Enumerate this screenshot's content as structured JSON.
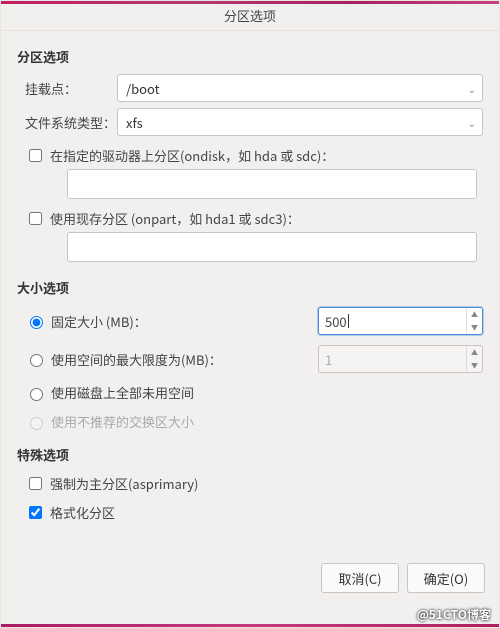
{
  "window": {
    "title": "分区选项"
  },
  "sections": {
    "partition": "分区选项",
    "size": "大小选项",
    "special": "特殊选项"
  },
  "mount": {
    "label": "挂载点：",
    "value": "/boot"
  },
  "fstype": {
    "label": "文件系统类型：",
    "value": "xfs"
  },
  "ondisk": {
    "label": "在指定的驱动器上分区(ondisk，如 hda 或 sdc)：",
    "value": ""
  },
  "onpart": {
    "label": "使用现存分区 (onpart，如 hda1 或 sdc3)：",
    "value": ""
  },
  "size_opts": {
    "fixed": {
      "label": "固定大小 (MB)：",
      "value": "500"
    },
    "max": {
      "label": "使用空间的最大限度为(MB)：",
      "value": "1"
    },
    "fill": {
      "label": "使用磁盘上全部未用空间"
    },
    "swap": {
      "label": "使用不推荐的交换区大小"
    }
  },
  "special": {
    "asprimary": {
      "label": "强制为主分区(asprimary)"
    },
    "format": {
      "label": "格式化分区"
    }
  },
  "buttons": {
    "cancel": "取消(C)",
    "ok": "确定(O)"
  },
  "watermark": "@51CTO博客"
}
